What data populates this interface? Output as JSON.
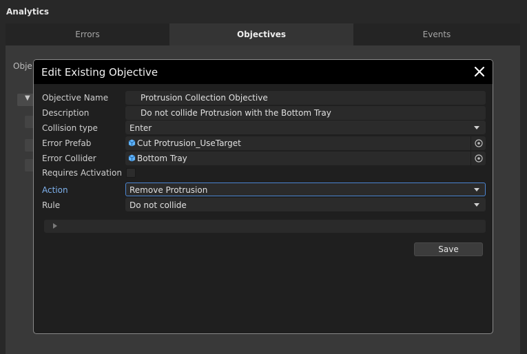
{
  "app": {
    "title": "Analytics"
  },
  "tabs": [
    {
      "label": "Errors"
    },
    {
      "label": "Objectives"
    },
    {
      "label": "Events"
    }
  ],
  "background": {
    "partial_label": "Obje"
  },
  "modal": {
    "title": "Edit Existing Objective",
    "fields": {
      "objective_name": {
        "label": "Objective Name",
        "value": "Protrusion Collection Objective"
      },
      "description": {
        "label": "Description",
        "value": "Do not collide Protrusion with the Bottom Tray"
      },
      "collision_type": {
        "label": "Collision type",
        "value": "Enter"
      },
      "error_prefab": {
        "label": "Error Prefab",
        "value": "Cut Protrusion_UseTarget",
        "icon": "cube-icon"
      },
      "error_collider": {
        "label": "Error Collider",
        "value": "Bottom Tray",
        "icon": "cube-icon"
      },
      "requires_activation": {
        "label": "Requires Activation",
        "checked": false
      },
      "action": {
        "label": "Action",
        "value": "Remove Protrusion"
      },
      "rule": {
        "label": "Rule",
        "value": "Do not collide"
      }
    },
    "save_label": "Save"
  },
  "colors": {
    "accent": "#4b86d3",
    "label_accent": "#7fb2ee",
    "icon_blue": "#5fb4ff"
  }
}
